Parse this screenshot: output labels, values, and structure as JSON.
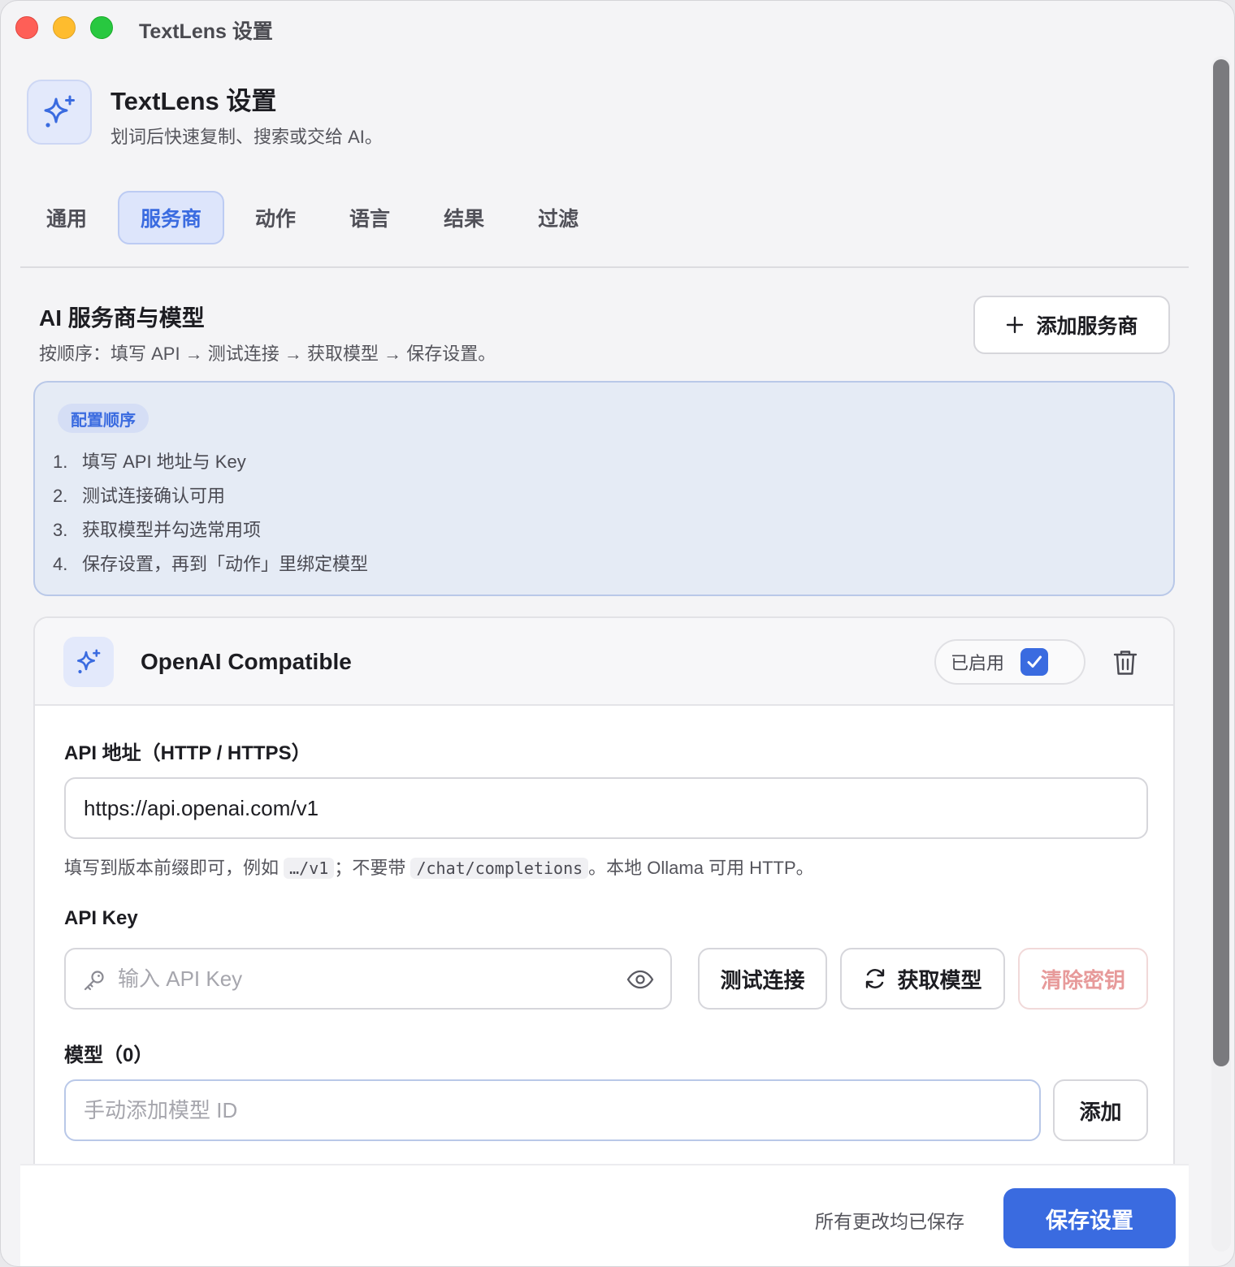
{
  "window": {
    "title": "TextLens 设置"
  },
  "header": {
    "title": "TextLens 设置",
    "subtitle": "划词后快速复制、搜索或交给 AI。",
    "icon": "sparkle-icon"
  },
  "tabs": [
    {
      "label": "通用",
      "active": false
    },
    {
      "label": "服务商",
      "active": true
    },
    {
      "label": "动作",
      "active": false
    },
    {
      "label": "语言",
      "active": false
    },
    {
      "label": "结果",
      "active": false
    },
    {
      "label": "过滤",
      "active": false
    }
  ],
  "section": {
    "title": "AI 服务商与模型",
    "subtitle": "按顺序：填写 API → 测试连接 → 获取模型 → 保存设置。",
    "add_button": "添加服务商"
  },
  "info": {
    "badge": "配置顺序",
    "steps": [
      {
        "num": "1.",
        "text": "填写 API 地址与 Key"
      },
      {
        "num": "2.",
        "text": "测试连接确认可用"
      },
      {
        "num": "3.",
        "text": "获取模型并勾选常用项"
      },
      {
        "num": "4.",
        "text": "保存设置，再到「动作」里绑定模型"
      }
    ]
  },
  "provider": {
    "name": "OpenAI Compatible",
    "enabled_label": "已启用",
    "enabled": true,
    "api_url_label": "API 地址（HTTP / HTTPS）",
    "api_url_value": "https://api.openai.com/v1",
    "hint_prefix": "填写到版本前缀即可，例如",
    "hint_code1": "…/v1",
    "hint_mid": "；不要带",
    "hint_code2": "/chat/completions",
    "hint_suffix": "。本地 Ollama 可用 HTTP。",
    "api_key_label": "API Key",
    "api_key_placeholder": "输入 API Key",
    "test_button": "测试连接",
    "fetch_button": "获取模型",
    "clear_button": "清除密钥",
    "models_label": "模型（0）",
    "model_placeholder": "手动添加模型 ID",
    "add_model_button": "添加"
  },
  "footer": {
    "status": "所有更改均已保存",
    "save_button": "保存设置"
  },
  "colors": {
    "accent": "#3a6be0",
    "danger": "#e79a9a"
  }
}
